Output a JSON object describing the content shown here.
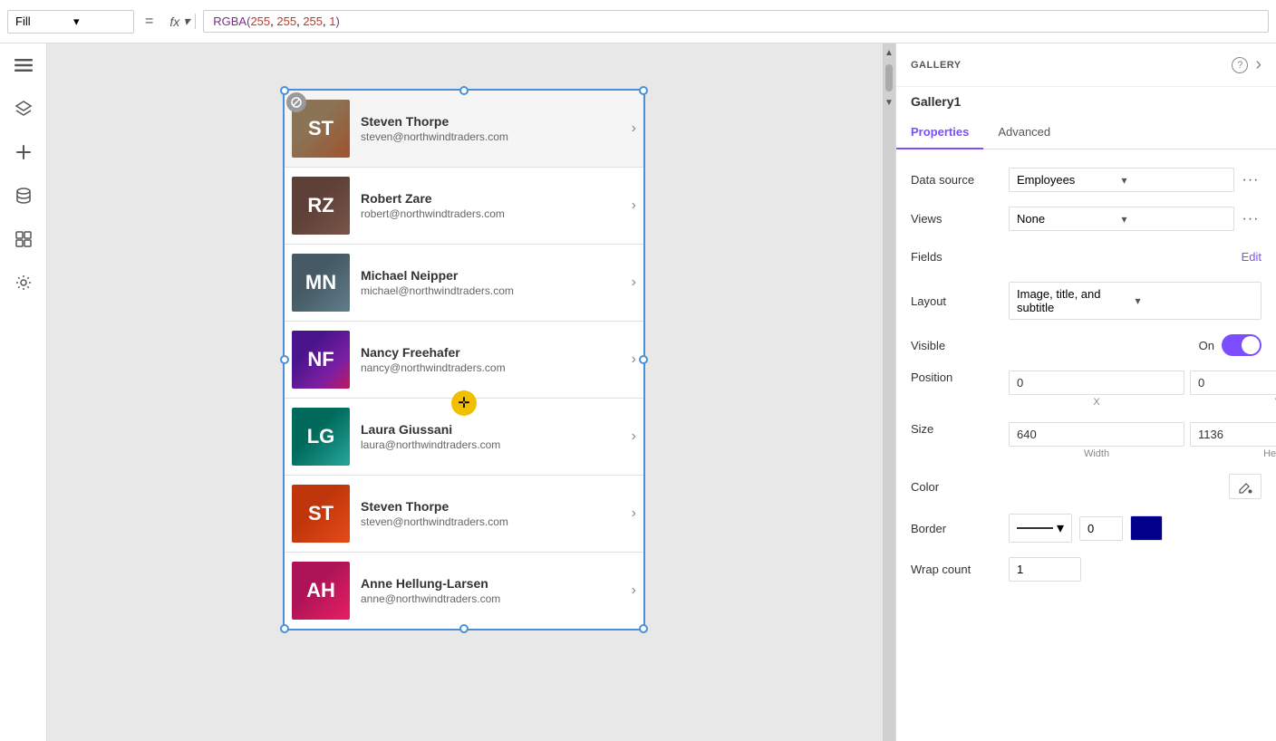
{
  "toolbar": {
    "fill_label": "Fill",
    "equals_symbol": "=",
    "fx_label": "fx",
    "formula": "RGBA(255, 255, 255, 1)"
  },
  "left_sidebar": {
    "icons": [
      {
        "name": "hamburger-icon",
        "symbol": "☰"
      },
      {
        "name": "layers-icon",
        "symbol": "⊞"
      },
      {
        "name": "add-icon",
        "symbol": "+"
      },
      {
        "name": "database-icon",
        "symbol": "⊟"
      },
      {
        "name": "components-icon",
        "symbol": "⊡"
      },
      {
        "name": "tools-icon",
        "symbol": "⚙"
      }
    ]
  },
  "gallery": {
    "items": [
      {
        "id": 1,
        "name": "Steven Thorpe",
        "email": "steven@northwindtraders.com",
        "avatar_class": "av1",
        "initials": "ST"
      },
      {
        "id": 2,
        "name": "Robert Zare",
        "email": "robert@northwindtraders.com",
        "avatar_class": "av2",
        "initials": "RZ"
      },
      {
        "id": 3,
        "name": "Michael Neipper",
        "email": "michael@northwindtraders.com",
        "avatar_class": "av3",
        "initials": "MN"
      },
      {
        "id": 4,
        "name": "Nancy Freehafer",
        "email": "nancy@northwindtraders.com",
        "avatar_class": "av4",
        "initials": "NF"
      },
      {
        "id": 5,
        "name": "Laura Giussani",
        "email": "laura@northwindtraders.com",
        "avatar_class": "av5",
        "initials": "LG"
      },
      {
        "id": 6,
        "name": "Steven Thorpe",
        "email": "steven@northwindtraders.com",
        "avatar_class": "av6",
        "initials": "ST"
      },
      {
        "id": 7,
        "name": "Anne Hellung-Larsen",
        "email": "anne@northwindtraders.com",
        "avatar_class": "av7",
        "initials": "AH"
      }
    ]
  },
  "right_panel": {
    "header": {
      "title": "GALLERY",
      "help_icon": "?",
      "expand_icon": "›"
    },
    "gallery_name": "Gallery1",
    "tabs": [
      {
        "label": "Properties",
        "active": true
      },
      {
        "label": "Advanced",
        "active": false
      }
    ],
    "properties": {
      "data_source_label": "Data source",
      "data_source_value": "Employees",
      "views_label": "Views",
      "views_value": "None",
      "fields_label": "Fields",
      "fields_edit": "Edit",
      "layout_label": "Layout",
      "layout_value": "Image, title, and subtitle",
      "visible_label": "Visible",
      "visible_state": "On",
      "position_label": "Position",
      "position_x": "0",
      "position_y": "0",
      "position_x_label": "X",
      "position_y_label": "Y",
      "size_label": "Size",
      "size_width": "640",
      "size_height": "1136",
      "size_width_label": "Width",
      "size_height_label": "Height",
      "color_label": "Color",
      "border_label": "Border",
      "border_thickness": "0",
      "wrap_count_label": "Wrap count",
      "wrap_count_value": "1"
    }
  }
}
